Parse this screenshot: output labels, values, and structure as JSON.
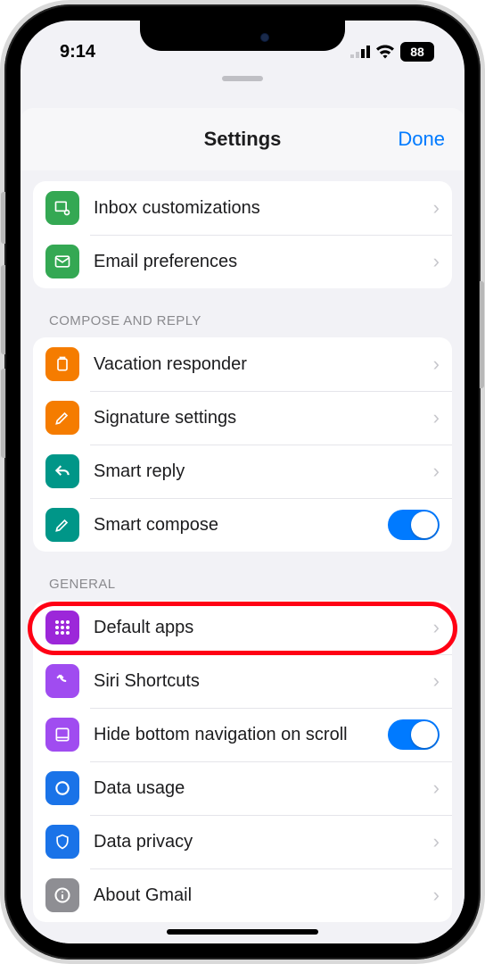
{
  "status": {
    "time": "9:14",
    "battery": "88"
  },
  "header": {
    "title": "Settings",
    "done": "Done"
  },
  "section_top": {
    "items": [
      {
        "label": "Inbox customizations"
      },
      {
        "label": "Email preferences"
      }
    ]
  },
  "section_compose": {
    "title": "COMPOSE AND REPLY",
    "items": [
      {
        "label": "Vacation responder"
      },
      {
        "label": "Signature settings"
      },
      {
        "label": "Smart reply"
      },
      {
        "label": "Smart compose"
      }
    ]
  },
  "section_general": {
    "title": "GENERAL",
    "items": [
      {
        "label": "Default apps"
      },
      {
        "label": "Siri Shortcuts"
      },
      {
        "label": "Hide bottom navigation on scroll"
      },
      {
        "label": "Data usage"
      },
      {
        "label": "Data privacy"
      },
      {
        "label": "About Gmail"
      }
    ]
  },
  "highlight": {
    "target": "default-apps-row"
  }
}
